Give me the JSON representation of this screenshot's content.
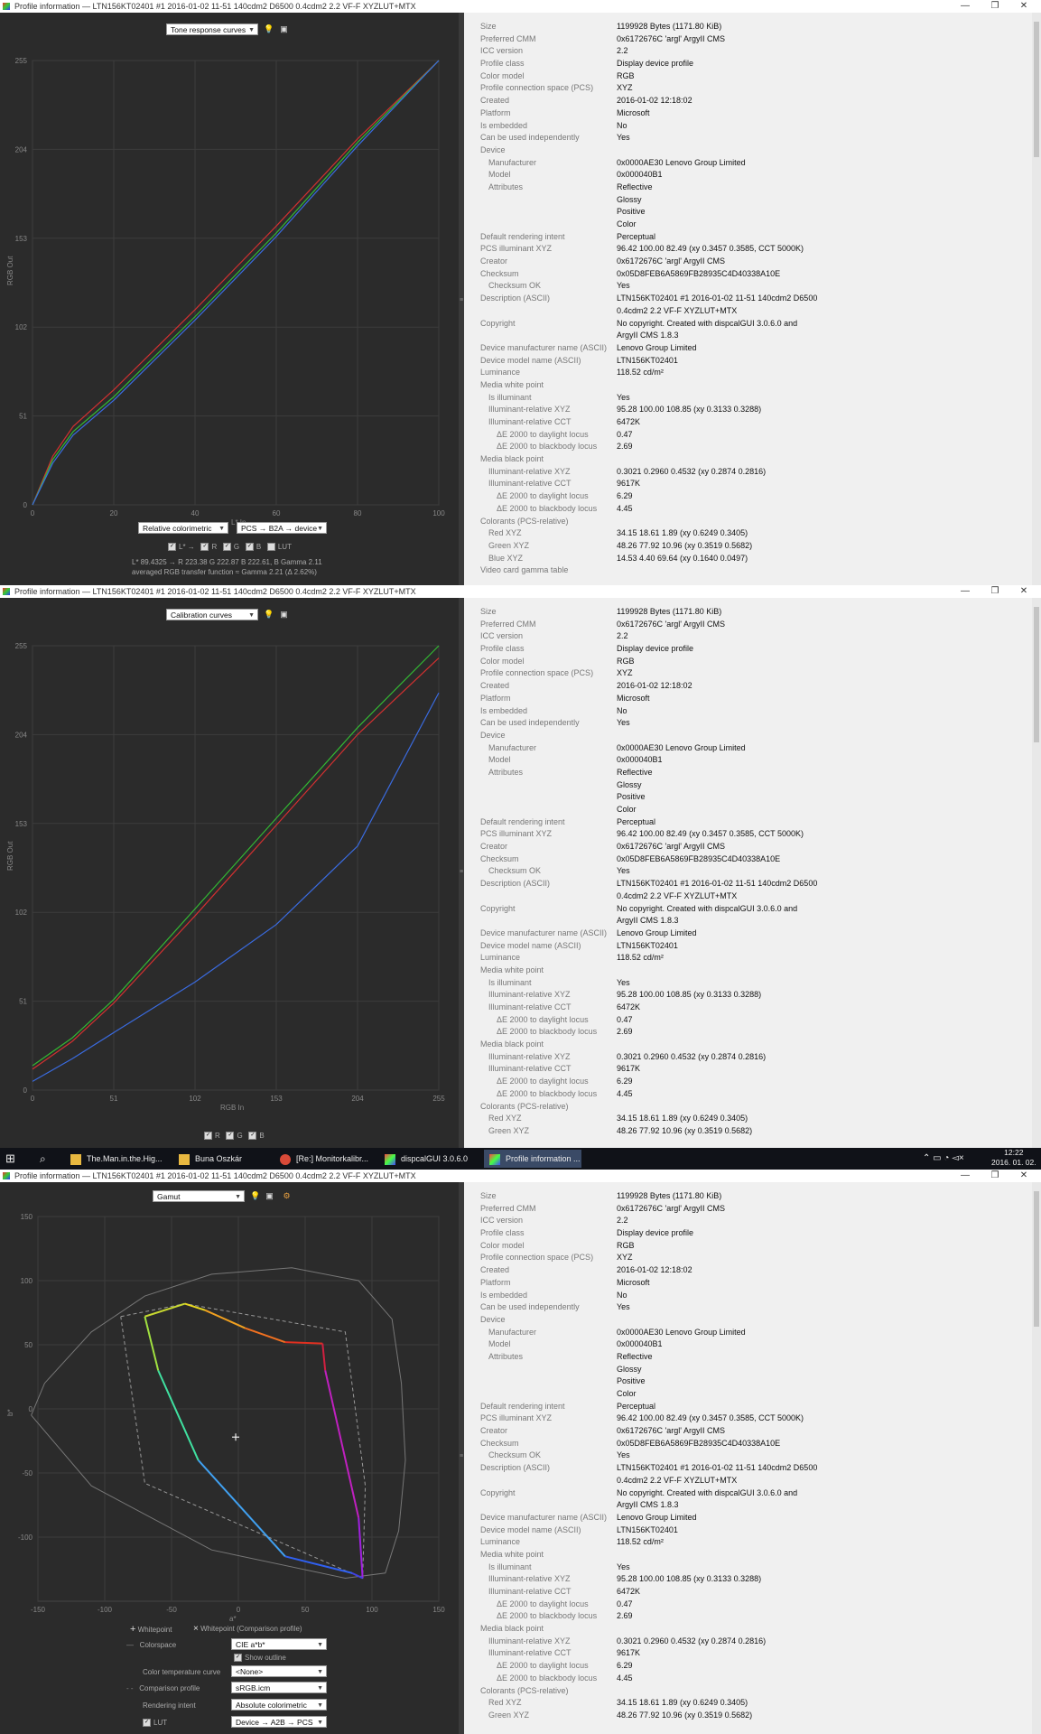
{
  "window_title": "Profile information — LTN156KT02401 #1 2016-01-02 11-51 140cdm2 D6500 0.4cdm2 2.2 VF-F XYZLUT+MTX",
  "window_controls": {
    "minimize": "—",
    "restore": "❐",
    "close": "✕"
  },
  "info_rows": [
    {
      "key": "Size",
      "value": "1199928 Bytes (1171.80 KiB)",
      "indent": 0
    },
    {
      "key": "Preferred CMM",
      "value": "0x6172676C 'argl' ArgyII CMS",
      "indent": 0
    },
    {
      "key": "ICC version",
      "value": "2.2",
      "indent": 0
    },
    {
      "key": "Profile class",
      "value": "Display device profile",
      "indent": 0
    },
    {
      "key": "Color model",
      "value": "RGB",
      "indent": 0
    },
    {
      "key": "Profile connection space (PCS)",
      "value": "XYZ",
      "indent": 0
    },
    {
      "key": "Created",
      "value": "2016-01-02 12:18:02",
      "indent": 0
    },
    {
      "key": "Platform",
      "value": "Microsoft",
      "indent": 0
    },
    {
      "key": "Is embedded",
      "value": "No",
      "indent": 0
    },
    {
      "key": "Can be used independently",
      "value": "Yes",
      "indent": 0
    },
    {
      "key": "Device",
      "value": "",
      "indent": 0
    },
    {
      "key": "Manufacturer",
      "value": "0x0000AE30 Lenovo Group Limited",
      "indent": 1
    },
    {
      "key": "Model",
      "value": "0x000040B1",
      "indent": 1
    },
    {
      "key": "Attributes",
      "value": "Reflective",
      "indent": 1
    },
    {
      "key": "",
      "value": "Glossy",
      "indent": 1
    },
    {
      "key": "",
      "value": "Positive",
      "indent": 1
    },
    {
      "key": "",
      "value": "Color",
      "indent": 1
    },
    {
      "key": "Default rendering intent",
      "value": "Perceptual",
      "indent": 0
    },
    {
      "key": "PCS illuminant XYZ",
      "value": "96.42 100.00  82.49 (xy 0.3457 0.3585, CCT 5000K)",
      "indent": 0
    },
    {
      "key": "Creator",
      "value": "0x6172676C 'argl' ArgyII CMS",
      "indent": 0
    },
    {
      "key": "Checksum",
      "value": "0x05D8FEB6A5869FB28935C4D40338A10E",
      "indent": 0
    },
    {
      "key": "Checksum OK",
      "value": "Yes",
      "indent": 1
    },
    {
      "key": "Description (ASCII)",
      "value": "LTN156KT02401 #1 2016-01-02 11-51 140cdm2 D6500",
      "indent": 0
    },
    {
      "key": "",
      "value": "0.4cdm2 2.2 VF-F XYZLUT+MTX",
      "indent": 0
    },
    {
      "key": "Copyright",
      "value": "No copyright. Created with dispcalGUI 3.0.6.0 and",
      "indent": 0
    },
    {
      "key": "",
      "value": "ArgyII CMS 1.8.3",
      "indent": 0
    },
    {
      "key": "Device manufacturer name (ASCII)",
      "value": "Lenovo Group Limited",
      "indent": 0
    },
    {
      "key": "Device model name (ASCII)",
      "value": "LTN156KT02401",
      "indent": 0
    },
    {
      "key": "Luminance",
      "value": "118.52 cd/m²",
      "indent": 0
    },
    {
      "key": "Media white point",
      "value": "",
      "indent": 0
    },
    {
      "key": "Is illuminant",
      "value": "Yes",
      "indent": 1
    },
    {
      "key": "Illuminant-relative XYZ",
      "value": "95.28 100.00 108.85 (xy 0.3133 0.3288)",
      "indent": 1
    },
    {
      "key": "Illuminant-relative CCT",
      "value": "6472K",
      "indent": 1
    },
    {
      "key": "ΔE 2000 to daylight locus",
      "value": "0.47",
      "indent": 2
    },
    {
      "key": "ΔE 2000 to blackbody locus",
      "value": "2.69",
      "indent": 2
    },
    {
      "key": "Media black point",
      "value": "",
      "indent": 0
    },
    {
      "key": "Illuminant-relative XYZ",
      "value": "0.3021 0.2960 0.4532 (xy 0.2874 0.2816)",
      "indent": 1
    },
    {
      "key": "Illuminant-relative CCT",
      "value": "9617K",
      "indent": 1
    },
    {
      "key": "ΔE 2000 to daylight locus",
      "value": "6.29",
      "indent": 2
    },
    {
      "key": "ΔE 2000 to blackbody locus",
      "value": "4.45",
      "indent": 2
    },
    {
      "key": "Colorants (PCS-relative)",
      "value": "",
      "indent": 0
    },
    {
      "key": "Red XYZ",
      "value": "34.15  18.61   1.89 (xy 0.6249 0.3405)",
      "indent": 1
    },
    {
      "key": "Green XYZ",
      "value": "48.26  77.92  10.96 (xy 0.3519 0.5682)",
      "indent": 1
    },
    {
      "key": "Blue XYZ",
      "value": "14.53   4.40  69.64 (xy 0.1640 0.0497)",
      "indent": 1
    },
    {
      "key": "Video card gamma table",
      "value": "",
      "indent": 0
    }
  ],
  "panel1": {
    "view_select": "Tone response curves",
    "y_axis_label": "RGB Out",
    "x_axis_label": "L* In",
    "y_ticks": [
      "255",
      "204",
      "153",
      "102",
      "51",
      "0"
    ],
    "x_ticks": [
      "0",
      "20",
      "40",
      "60",
      "80",
      "100"
    ],
    "intent_select": "Relative colorimetric",
    "direction_select": "PCS → B2A → device",
    "checkboxes": [
      "L* →",
      "R",
      "G",
      "B",
      "LUT"
    ],
    "readout_line1": "L* 89.4325 → R 223.38 G 222.87 B 222.61, B Gamma 2.11",
    "readout_line2": "averaged RGB transfer function ≈ Gamma 2.21 (Δ 2.62%)"
  },
  "panel2": {
    "view_select": "Calibration curves",
    "y_axis_label": "RGB Out",
    "x_axis_label": "RGB In",
    "y_ticks": [
      "255",
      "204",
      "153",
      "102",
      "51",
      "0"
    ],
    "x_ticks": [
      "0",
      "51",
      "102",
      "153",
      "204",
      "255"
    ],
    "checkboxes": [
      "R",
      "G",
      "B"
    ]
  },
  "panel3": {
    "view_select": "Gamut",
    "y_axis_label": "b*",
    "x_axis_label": "a*",
    "y_ticks": [
      "150",
      "100",
      "50",
      "0",
      "-50",
      "-100"
    ],
    "x_ticks": [
      "-150",
      "-100",
      "-50",
      "0",
      "50",
      "100",
      "150"
    ],
    "legend_whitepoint": "Whitepoint",
    "legend_whitepoint_cmp": "Whitepoint (Comparison profile)",
    "options": [
      {
        "label": "Colorspace",
        "value": "CIE a*b*"
      },
      {
        "label": "Color temperature curve",
        "value": "<None>"
      },
      {
        "label": "Comparison profile",
        "value": "sRGB.icm"
      },
      {
        "label": "Rendering intent",
        "value": "Absolute colorimetric"
      },
      {
        "label": "LUT",
        "value": "Device → A2B → PCS"
      }
    ],
    "show_outline": "Show outline"
  },
  "chart_data": [
    {
      "type": "line",
      "title": "Tone response curves",
      "xlabel": "L* In",
      "ylabel": "RGB Out",
      "xlim": [
        0,
        100
      ],
      "ylim": [
        0,
        255
      ],
      "grid": true,
      "series": [
        {
          "name": "R",
          "color": "#d23030",
          "x": [
            0,
            5,
            10,
            20,
            40,
            60,
            80,
            100
          ],
          "values": [
            0,
            28,
            45,
            66,
            112,
            160,
            210,
            255
          ]
        },
        {
          "name": "G",
          "color": "#33b833",
          "x": [
            0,
            5,
            10,
            20,
            40,
            60,
            80,
            100
          ],
          "values": [
            0,
            26,
            42,
            62,
            108,
            156,
            208,
            255
          ]
        },
        {
          "name": "B",
          "color": "#3a6be0",
          "x": [
            0,
            5,
            10,
            20,
            40,
            60,
            80,
            100
          ],
          "values": [
            0,
            24,
            40,
            60,
            106,
            154,
            206,
            255
          ]
        }
      ]
    },
    {
      "type": "line",
      "title": "Calibration curves",
      "xlabel": "RGB In",
      "ylabel": "RGB Out",
      "xlim": [
        0,
        255
      ],
      "ylim": [
        0,
        255
      ],
      "grid": true,
      "series": [
        {
          "name": "R",
          "color": "#d23030",
          "x": [
            0,
            25,
            51,
            102,
            153,
            204,
            255
          ],
          "values": [
            12,
            28,
            50,
            100,
            152,
            204,
            248
          ]
        },
        {
          "name": "G",
          "color": "#33b833",
          "x": [
            0,
            25,
            51,
            102,
            153,
            204,
            255
          ],
          "values": [
            14,
            30,
            52,
            104,
            156,
            208,
            255
          ]
        },
        {
          "name": "B",
          "color": "#3a6be0",
          "x": [
            0,
            25,
            51,
            102,
            153,
            204,
            255
          ],
          "values": [
            5,
            18,
            33,
            62,
            95,
            140,
            228
          ]
        }
      ]
    },
    {
      "type": "scatter",
      "title": "Gamut",
      "xlabel": "a*",
      "ylabel": "b*",
      "xlim": [
        -150,
        150
      ],
      "ylim": [
        -150,
        150
      ],
      "grid": true,
      "series": [
        {
          "name": "profile gamut",
          "x": [
            -70,
            -40,
            -25,
            5,
            35,
            63,
            65,
            90,
            93,
            85,
            35,
            -30,
            -60,
            -70
          ],
          "values": [
            72,
            82,
            77,
            63,
            52,
            51,
            30,
            -85,
            -132,
            -128,
            -115,
            -40,
            30,
            72
          ]
        },
        {
          "name": "Comparison profile",
          "x": [
            -88,
            -40,
            80,
            95,
            93,
            -70,
            -88
          ],
          "values": [
            72,
            82,
            60,
            -60,
            -132,
            -58,
            72
          ]
        },
        {
          "name": "Whitepoint",
          "x": [
            -2
          ],
          "values": [
            -22
          ]
        }
      ]
    }
  ],
  "taskbar": {
    "items": [
      "The.Man.in.the.Hig...",
      "Buna Oszkár",
      "[Re:] Monitorkalibr...",
      "dispcalGUI 3.0.6.0",
      "Profile information ..."
    ],
    "time": "12:22",
    "date": "2016. 01. 02."
  }
}
